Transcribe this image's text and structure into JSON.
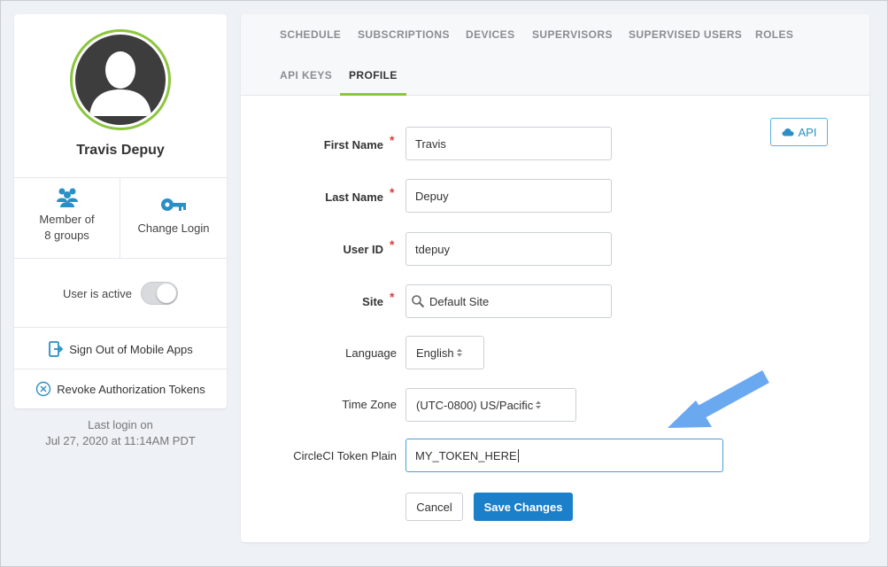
{
  "profile": {
    "name": "Travis Depuy",
    "member_of_line1": "Member of",
    "member_of_line2": "8 groups",
    "change_login": "Change Login",
    "user_active_label": "User is active",
    "sign_out_mobile": "Sign Out of Mobile Apps",
    "revoke_tokens": "Revoke Authorization Tokens",
    "last_login_line1": "Last login on",
    "last_login_line2": "Jul 27, 2020 at 11:14AM PDT",
    "user_active": true
  },
  "tabs": [
    {
      "label": "SCHEDULE"
    },
    {
      "label": "SUBSCRIPTIONS"
    },
    {
      "label": "DEVICES"
    },
    {
      "label": "SUPERVISORS"
    },
    {
      "label": "SUPERVISED USERS"
    },
    {
      "label": "ROLES"
    },
    {
      "label": "API KEYS"
    },
    {
      "label": "PROFILE",
      "active": true
    }
  ],
  "api_button": "API",
  "form": {
    "first_name": {
      "label": "First Name",
      "value": "Travis",
      "required": true
    },
    "last_name": {
      "label": "Last Name",
      "value": "Depuy",
      "required": true
    },
    "user_id": {
      "label": "User ID",
      "value": "tdepuy",
      "required": true
    },
    "site": {
      "label": "Site",
      "value": "Default Site",
      "required": true
    },
    "language": {
      "label": "Language",
      "value": "English"
    },
    "time_zone": {
      "label": "Time Zone",
      "value": "(UTC-0800) US/Pacific"
    },
    "token": {
      "label": "CircleCI Token Plain",
      "value": "MY_TOKEN_HERE"
    }
  },
  "buttons": {
    "cancel": "Cancel",
    "save": "Save Changes"
  },
  "colors": {
    "accent_green": "#8cc63f",
    "primary_blue": "#1b7fc9",
    "icon_blue": "#2a8fc4",
    "required_red": "#e03b3b",
    "arrow_blue": "#6aa8f0"
  }
}
